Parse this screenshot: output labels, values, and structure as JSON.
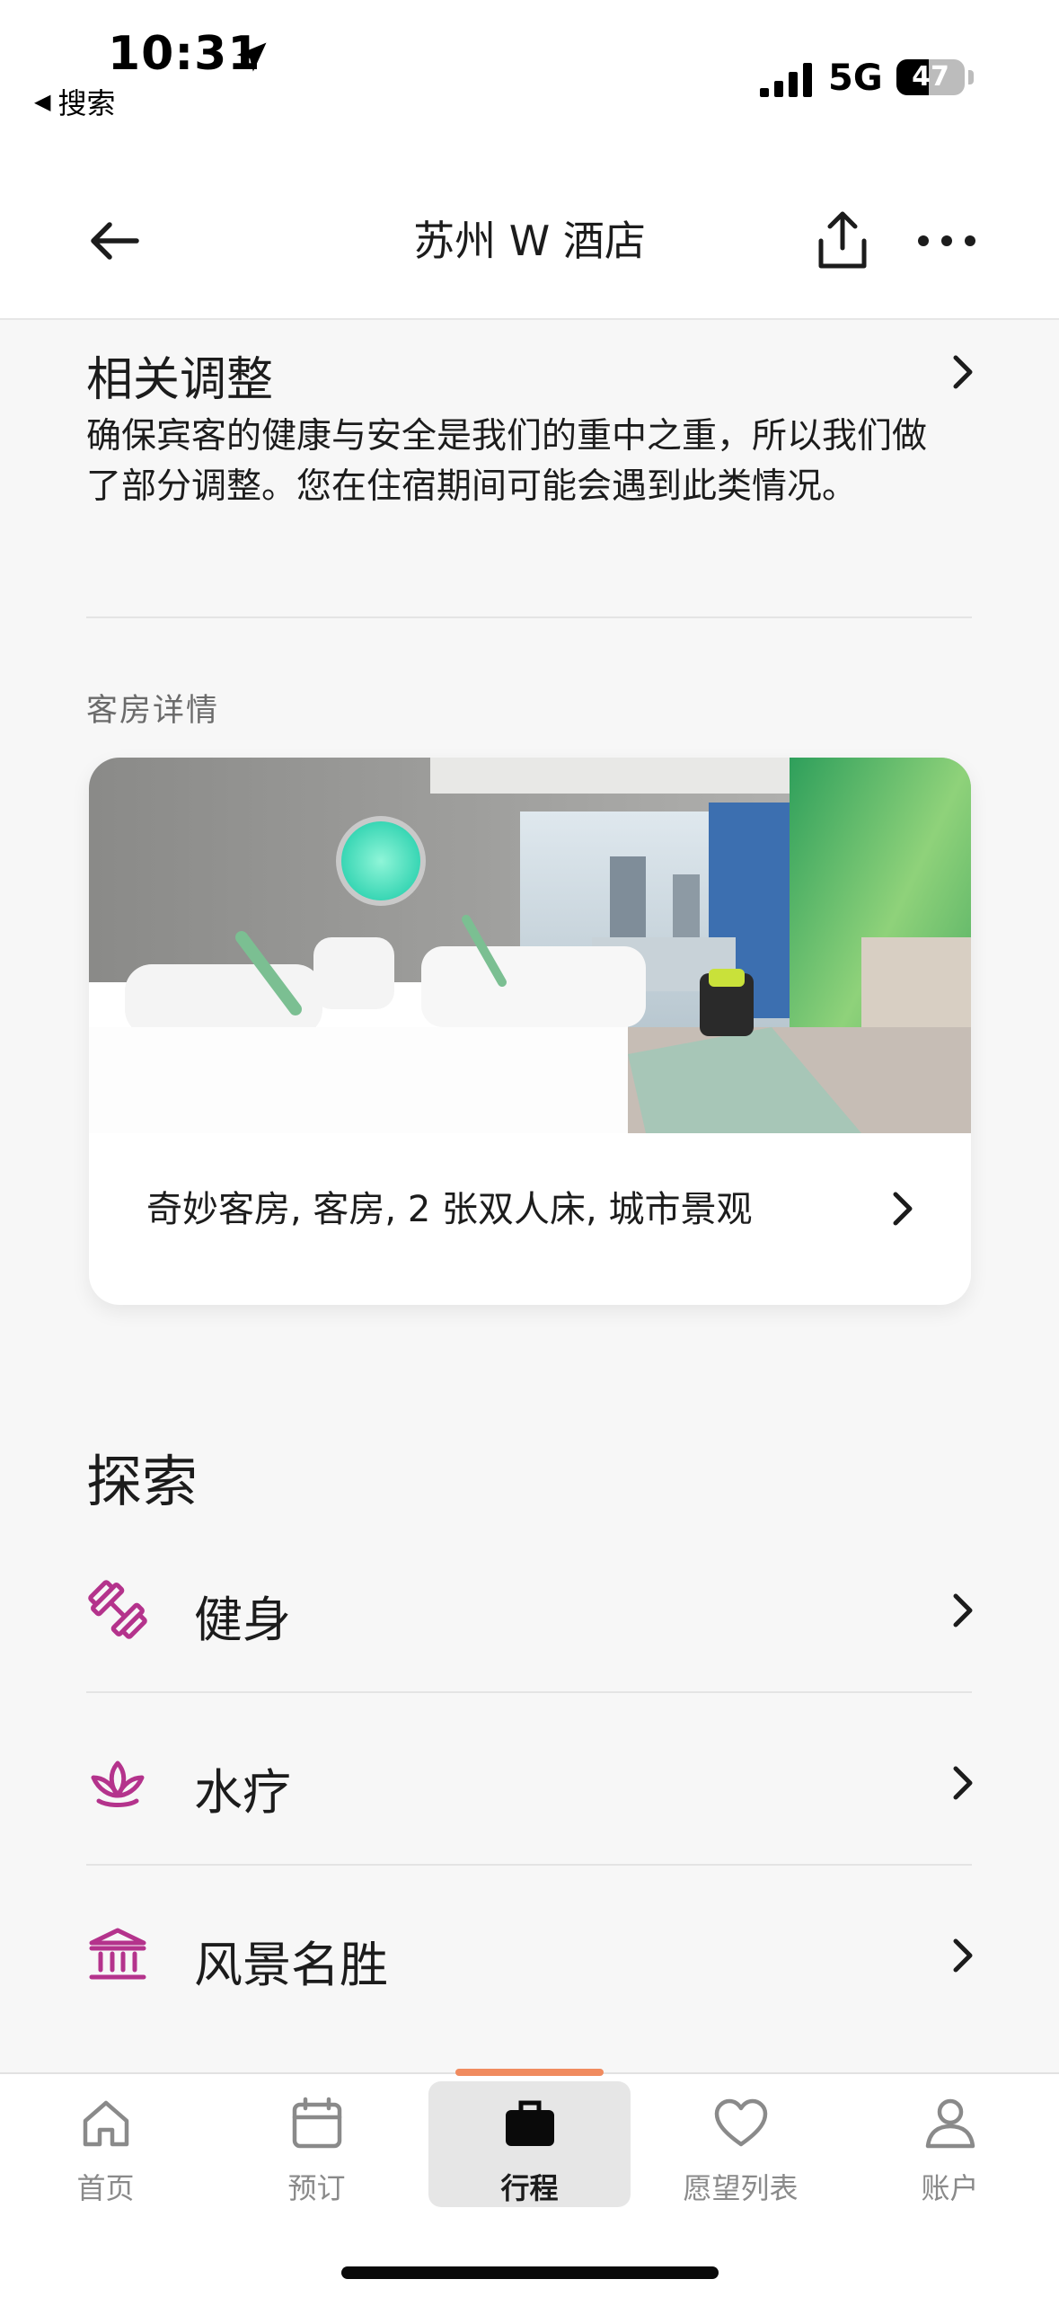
{
  "status_bar": {
    "time": "10:31",
    "back_app_label": "搜索",
    "network": "5G",
    "battery": "47",
    "battery_level": 0.47
  },
  "header": {
    "title": "苏州 W 酒店"
  },
  "adjustments": {
    "title": "相关调整",
    "body": "确保宾客的健康与安全是我们的重中之重，所以我们做了部分调整。您在住宿期间可能会遇到此类情况。"
  },
  "room_details": {
    "section_label": "客房详情",
    "room_label": "奇妙客房, 客房, 2 张双人床, 城市景观"
  },
  "explore": {
    "title": "探索",
    "items": [
      {
        "label": "健身",
        "icon": "dumbbell-icon"
      },
      {
        "label": "水疗",
        "icon": "lotus-icon"
      },
      {
        "label": "风景名胜",
        "icon": "landmark-icon"
      }
    ]
  },
  "tabbar": {
    "items": [
      {
        "label": "首页",
        "icon": "home-icon"
      },
      {
        "label": "预订",
        "icon": "calendar-icon"
      },
      {
        "label": "行程",
        "icon": "briefcase-icon",
        "active": true
      },
      {
        "label": "愿望列表",
        "icon": "heart-icon"
      },
      {
        "label": "账户",
        "icon": "person-icon"
      }
    ]
  },
  "colors": {
    "accent": "#b4338c",
    "active_tab_indicator": "#f08b5f",
    "background": "#f7f7f7"
  }
}
